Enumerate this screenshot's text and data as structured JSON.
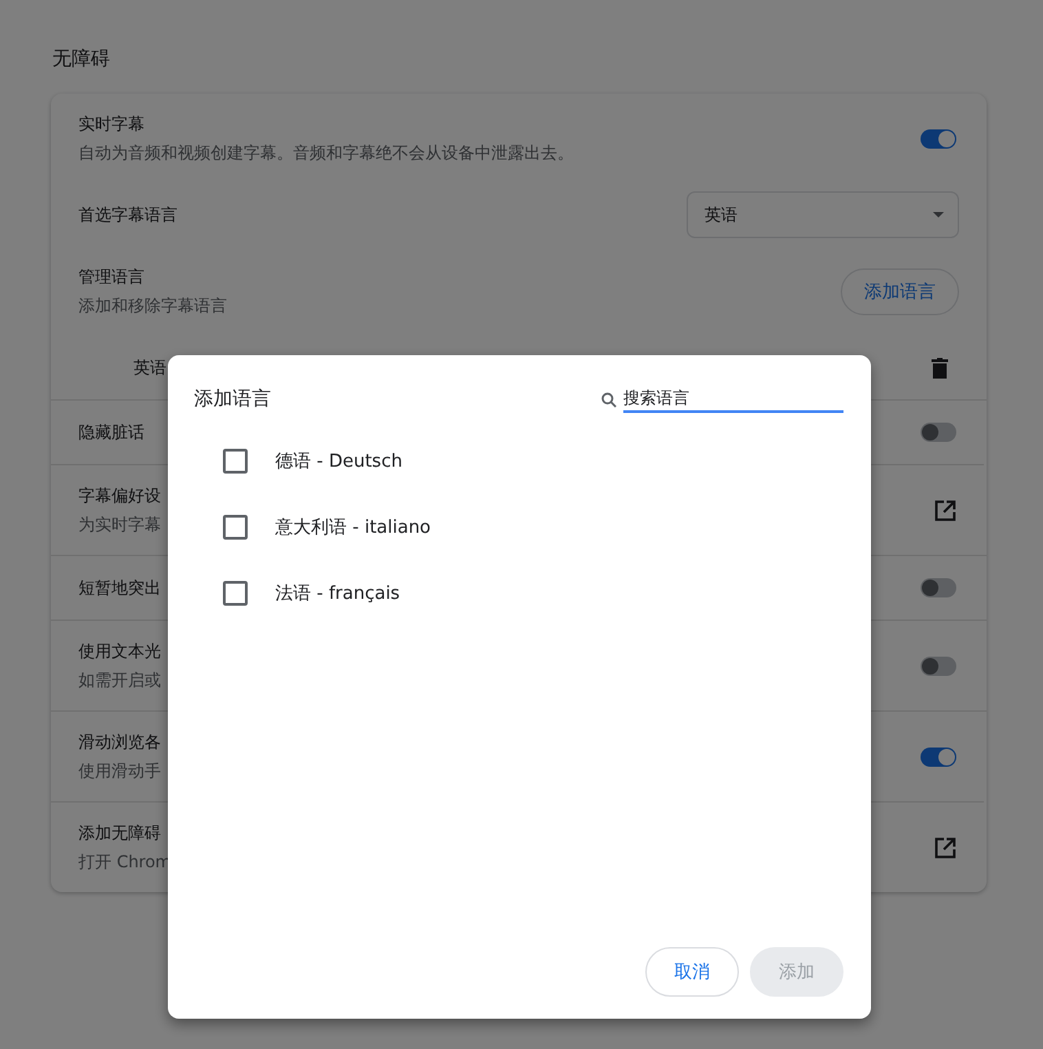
{
  "section_title": "无障碍",
  "settings": [
    {
      "kind": "toggle",
      "title": "实时字幕",
      "description": "自动为音频和视频创建字幕。音频和字幕绝不会从设备中泄露出去。",
      "on": true
    },
    {
      "kind": "select",
      "title": "首选字幕语言",
      "value": "英语"
    },
    {
      "kind": "button",
      "title": "管理语言",
      "description": "添加和移除字幕语言",
      "button": "添加语言"
    },
    {
      "kind": "language",
      "title": "英语"
    },
    {
      "kind": "toggle",
      "title": "隐藏脏话",
      "on": false
    },
    {
      "kind": "link",
      "title": "字幕偏好设",
      "description": "为实时字幕"
    },
    {
      "kind": "toggle",
      "title": "短暂地突出",
      "on": false
    },
    {
      "kind": "toggle",
      "title": "使用文本光",
      "description": "如需开启或",
      "on": false
    },
    {
      "kind": "toggle",
      "title": "滑动浏览各",
      "description": "使用滑动手",
      "on": true
    },
    {
      "kind": "link",
      "title": "添加无障碍",
      "description": "打开 Chrom"
    }
  ],
  "dialog": {
    "title": "添加语言",
    "search": {
      "placeholder": "搜索语言"
    },
    "languages": [
      {
        "label": "德语 - Deutsch",
        "checked": false
      },
      {
        "label": "意大利语 - italiano",
        "checked": false
      },
      {
        "label": "法语 - français",
        "checked": false
      }
    ],
    "buttons": [
      {
        "label": "取消",
        "disabled": false
      },
      {
        "label": "添加",
        "disabled": true
      }
    ]
  }
}
